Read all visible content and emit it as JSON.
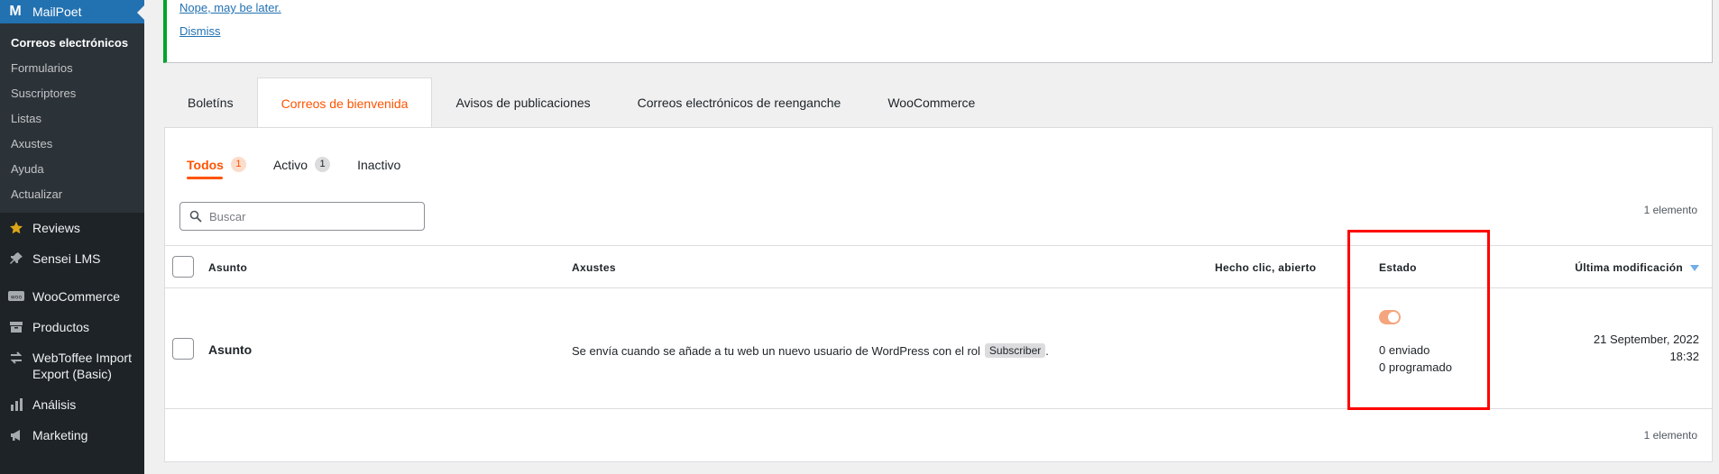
{
  "sidebar": {
    "title": "MailPoet",
    "submenu": [
      {
        "label": "Correos electrónicos",
        "current": true
      },
      {
        "label": "Formularios"
      },
      {
        "label": "Suscriptores"
      },
      {
        "label": "Listas"
      },
      {
        "label": "Axustes"
      },
      {
        "label": "Ayuda"
      },
      {
        "label": "Actualizar"
      }
    ],
    "menu": [
      {
        "label": "Reviews",
        "icon": "star-icon"
      },
      {
        "label": "Sensei LMS",
        "icon": "pin-icon"
      },
      {
        "label": "WooCommerce",
        "icon": "woocommerce-icon"
      },
      {
        "label": "Productos",
        "icon": "archive-icon"
      },
      {
        "label": "WebToffee Import Export (Basic)",
        "icon": "import-export-icon"
      },
      {
        "label": "Análisis",
        "icon": "bar-chart-icon"
      },
      {
        "label": "Marketing",
        "icon": "megaphone-icon"
      }
    ]
  },
  "notice": {
    "link_later": "Nope, may be later.",
    "link_dismiss": "Dismiss"
  },
  "tabs": [
    {
      "label": "Boletíns"
    },
    {
      "label": "Correos de bienvenida",
      "active": true
    },
    {
      "label": "Avisos de publicaciones"
    },
    {
      "label": "Correos electrónicos de reenganche"
    },
    {
      "label": "WooCommerce"
    }
  ],
  "filters": [
    {
      "label": "Todos",
      "count": "1",
      "active": true
    },
    {
      "label": "Activo",
      "count": "1"
    },
    {
      "label": "Inactivo"
    }
  ],
  "search": {
    "placeholder": "Buscar"
  },
  "item_count": "1 elemento",
  "table": {
    "headers": {
      "subject": "Asunto",
      "settings": "Axustes",
      "clicked": "Hecho clic, abierto",
      "status": "Estado",
      "modified": "Última modificación"
    },
    "row": {
      "subject": "Asunto",
      "settings_text": "Se envía cuando se añade a tu web un nuevo usuario de WordPress con el rol",
      "role": "Subscriber",
      "settings_end": ".",
      "status_active": true,
      "sent": "0 enviado",
      "scheduled": "0 programado",
      "date": "21 September, 2022",
      "time": "18:32"
    }
  },
  "colors": {
    "accent": "#ff5301",
    "highlight": "#ff0000",
    "sidebar_bg": "#1d2327",
    "notice_border": "#00a32a"
  }
}
